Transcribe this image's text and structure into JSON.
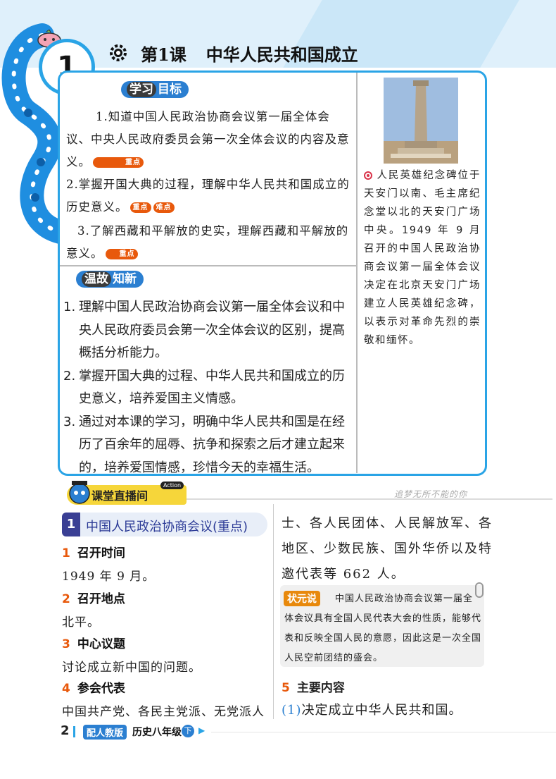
{
  "header": {
    "lesson_number": "1",
    "lesson_label": "第1课",
    "lesson_name": "中华人民共和国成立"
  },
  "objectives": {
    "title_part1": "学习",
    "title_part2": "目标",
    "items": [
      {
        "text": "1.知道中国人民政治协商会议第一届全体会议、中央人民政府委员会第一次全体会议的内容及意义。",
        "badges": [
          "重点"
        ]
      },
      {
        "text": "2.掌握开国大典的过程，理解中华人民共和国成立的历史意义。",
        "badges": [
          "重点",
          "难点"
        ]
      },
      {
        "text": "3.了解西藏和平解放的史实，理解西藏和平解放的意义。",
        "badges": [
          "重点"
        ]
      }
    ]
  },
  "review": {
    "title_part1": "温故",
    "title_part2": "知新",
    "items": [
      {
        "num": "1.",
        "text": "理解中国人民政治协商会议第一届全体会议和中央人民政府委员会第一次全体会议的区别，提高概括分析能力。"
      },
      {
        "num": "2.",
        "text": "掌握开国大典的过程、中华人民共和国成立的历史意义，培养爱国主义情感。"
      },
      {
        "num": "3.",
        "text": "通过对本课的学习，明确中华人民共和国是在经历了百余年的屈辱、抗争和探索之后才建立起来的，培养爱国情感，珍惜今天的幸福生活。"
      }
    ]
  },
  "sidebar": {
    "caption": "人民英雄纪念碑位于天安门以南、毛主席纪念堂以北的天安门广场中央。1949 年 9 月召开的中国人民政治协商会议第一届全体会议决定在北京天安门广场建立人民英雄纪念碑，以表示对革命先烈的崇敬和缅怀。"
  },
  "live": {
    "label": "课堂直播间",
    "action_tag": "Action",
    "slogan": "追梦无所不能的你"
  },
  "topic": {
    "number": "1",
    "title": "中国人民政治协商会议(重点)"
  },
  "sections": [
    {
      "num": "1",
      "heading": "召开时间",
      "body": "1949 年 9 月。"
    },
    {
      "num": "2",
      "heading": "召开地点",
      "body": "北平。"
    },
    {
      "num": "3",
      "heading": "中心议题",
      "body": "讨论成立新中国的问题。"
    },
    {
      "num": "4",
      "heading": "参会代表",
      "body": "中国共产党、各民主党派、无党派人"
    }
  ],
  "right_column": {
    "continuation": "士、各人民团体、人民解放军、各地区、少数民族、国外华侨以及特邀代表等 662 人。",
    "note_tag": "状元说",
    "note_text": "中国人民政治协商会议第一届全体会议具有全国人民代表大会的性质，能够代表和反映全国人民的意愿，因此这是一次全国人民空前团结的盛会。",
    "section5_num": "5",
    "section5_heading": "主要内容",
    "point1_num": "(1)",
    "point1_text": "决定成立中华人民共和国。"
  },
  "footer": {
    "page_number": "2",
    "edition": "配人教版",
    "grade": "历史八年级",
    "volume": "下"
  }
}
